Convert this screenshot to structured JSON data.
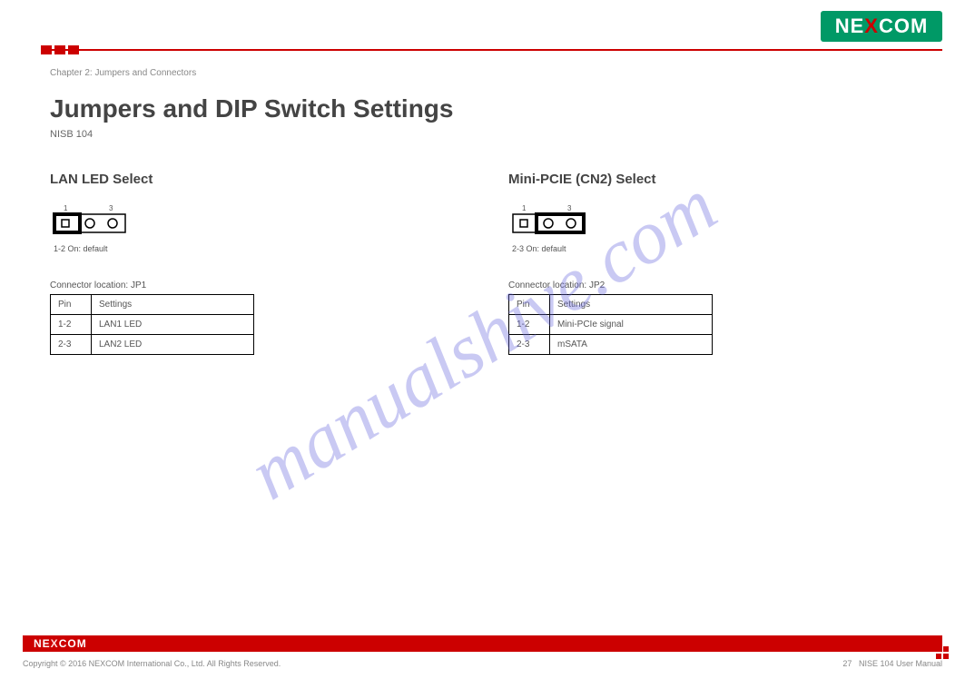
{
  "header": {
    "logo_main": "NE",
    "logo_x": "X",
    "logo_end": "COM"
  },
  "chapter": {
    "label": "Chapter 2: Jumpers and Connectors",
    "title": "Jumpers and DIP Switch Settings",
    "subtitle": "NISB 104"
  },
  "left": {
    "section_title": "LAN LED Select",
    "pin_diagram_numbers": [
      "1",
      "3"
    ],
    "pin_caption": "1-2 On: default",
    "connector_label": "Connector location: JP1",
    "table": {
      "headers": [
        "Pin",
        "Settings"
      ],
      "rows": [
        [
          "1-2",
          "LAN1 LED"
        ],
        [
          "2-3",
          "LAN2 LED"
        ]
      ]
    }
  },
  "right": {
    "section_title": "Mini-PCIE (CN2) Select",
    "pin_diagram_numbers": [
      "1",
      "3"
    ],
    "pin_caption": "2-3 On: default",
    "connector_label": "Connector location: JP2",
    "table": {
      "headers": [
        "Pin",
        "Settings"
      ],
      "rows": [
        [
          "1-2",
          "Mini-PCIe signal"
        ],
        [
          "2-3",
          "mSATA"
        ]
      ]
    }
  },
  "watermark": "manualshive.com",
  "footer": {
    "logo_main": "NE",
    "logo_x": "X",
    "logo_end": "COM",
    "copyright": "Copyright © 2016 NEXCOM International Co., Ltd. All Rights Reserved.",
    "page": "27",
    "product": "NISE 104 User Manual"
  }
}
